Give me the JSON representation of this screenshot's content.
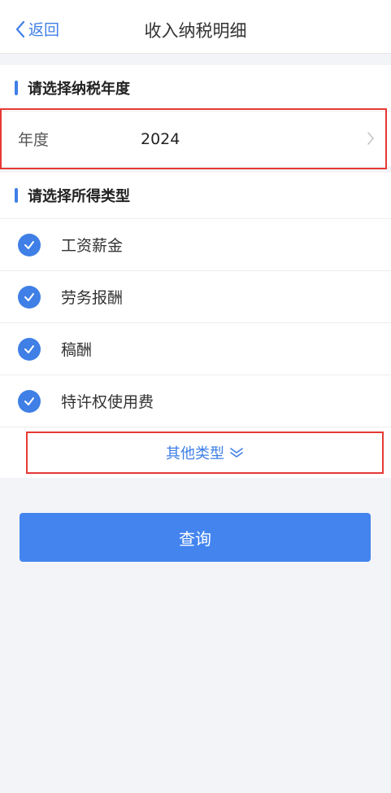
{
  "nav": {
    "back_label": "返回",
    "title": "收入纳税明细"
  },
  "year_section": {
    "header": "请选择纳税年度",
    "label": "年度",
    "value": "2024"
  },
  "type_section": {
    "header": "请选择所得类型",
    "items": [
      {
        "label": "工资薪金",
        "checked": true
      },
      {
        "label": "劳务报酬",
        "checked": true
      },
      {
        "label": "稿酬",
        "checked": true
      },
      {
        "label": "特许权使用费",
        "checked": true
      }
    ],
    "more_label": "其他类型"
  },
  "query_button": "查询",
  "colors": {
    "accent": "#3f7fe6",
    "button": "#4384ef",
    "highlight": "#e53935",
    "background": "#f3f4f7"
  }
}
